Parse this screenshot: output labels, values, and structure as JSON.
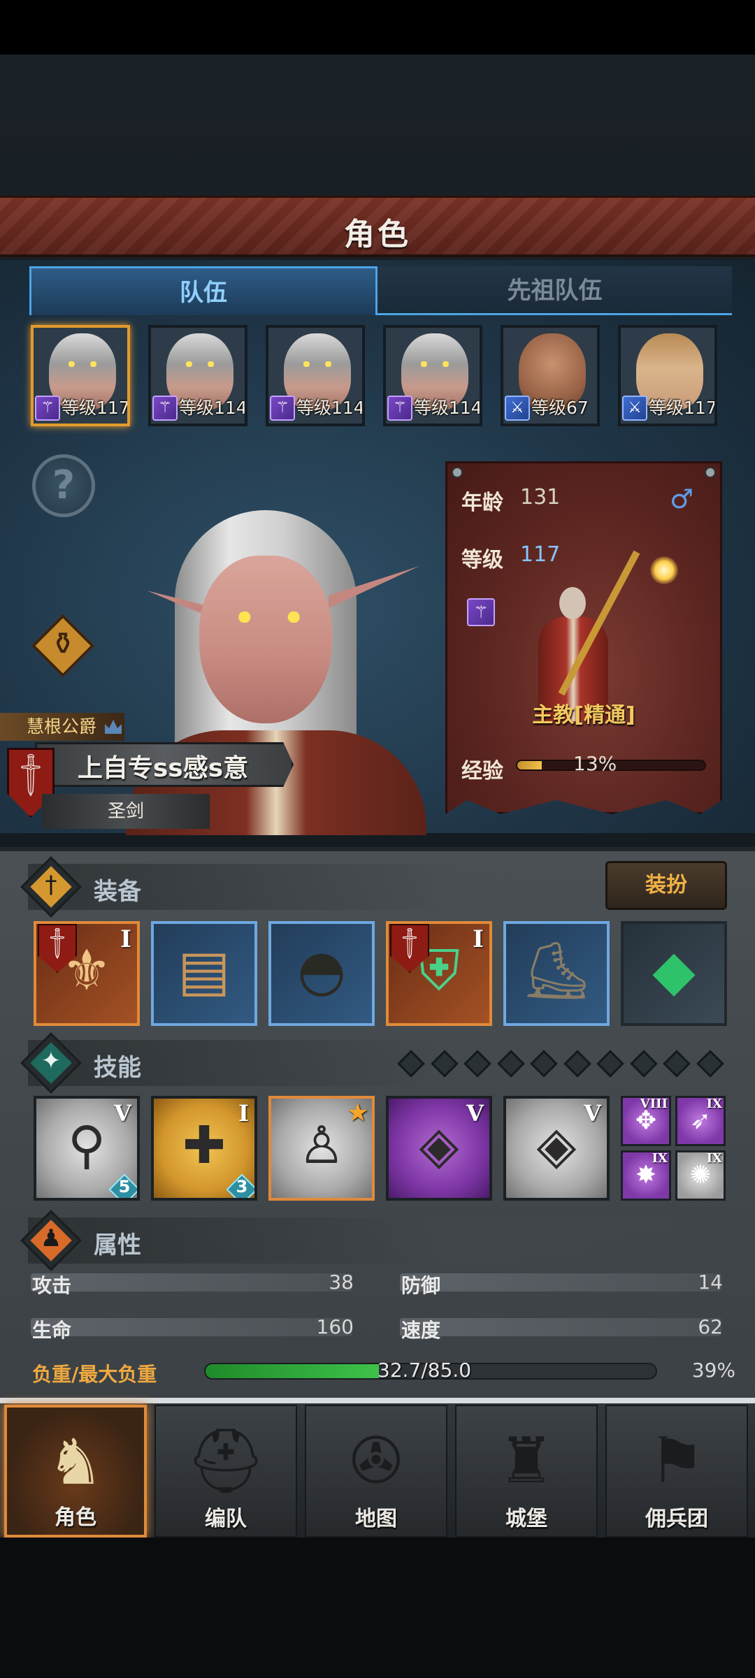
{
  "header": {
    "title": "角色"
  },
  "tabs": [
    {
      "label": "队伍",
      "active": true
    },
    {
      "label": "先祖队伍",
      "active": false
    }
  ],
  "party": [
    {
      "level_text": "等级117",
      "class_icon": "staff-icon",
      "selected": true,
      "portrait": "elf"
    },
    {
      "level_text": "等级114",
      "class_icon": "staff-icon",
      "selected": false,
      "portrait": "elf"
    },
    {
      "level_text": "等级114",
      "class_icon": "staff-icon",
      "selected": false,
      "portrait": "elf"
    },
    {
      "level_text": "等级114",
      "class_icon": "staff-icon",
      "selected": false,
      "portrait": "elf"
    },
    {
      "level_text": "等级67",
      "class_icon": "sword-icon",
      "selected": false,
      "portrait": "bald"
    },
    {
      "level_text": "等级117",
      "class_icon": "sword-icon",
      "selected": false,
      "portrait": "woman"
    }
  ],
  "hero": {
    "noble_title": "慧根公爵",
    "name": "上自专ss感s意",
    "subtitle": "圣剑"
  },
  "info": {
    "age_label": "年龄",
    "age_value": "131",
    "level_label": "等级",
    "level_value": "117",
    "gender_symbol": "♂",
    "class_name": "主教[精通]",
    "exp_label": "经验",
    "exp_percent_text": "13%",
    "exp_fraction": 0.13
  },
  "equipment": {
    "title": "装备",
    "dress_button": "装扮",
    "slots": [
      {
        "name": "weapon",
        "rarity": "orange",
        "tier": "I",
        "icon": "scepter-icon"
      },
      {
        "name": "offhand",
        "rarity": "blue",
        "tier": "",
        "icon": "book-icon"
      },
      {
        "name": "head",
        "rarity": "blue",
        "tier": "",
        "icon": "hood-icon"
      },
      {
        "name": "armor",
        "rarity": "orange",
        "tier": "I",
        "icon": "armor-icon"
      },
      {
        "name": "boots",
        "rarity": "blue",
        "tier": "",
        "icon": "boots-icon"
      },
      {
        "name": "accessory",
        "rarity": "dark",
        "tier": "",
        "icon": "gem-icon"
      }
    ]
  },
  "skills": {
    "title": "技能",
    "pip_count": 10,
    "main": [
      {
        "color": "gray",
        "tier": "V",
        "badge": "5",
        "icon": "holy-spear-icon"
      },
      {
        "color": "gold",
        "tier": "I",
        "badge": "3",
        "icon": "holy-shield-icon"
      },
      {
        "color": "gray",
        "tier": "",
        "badge": "",
        "icon": "prayer-icon",
        "selected": true,
        "starred": true
      },
      {
        "color": "purple",
        "tier": "V",
        "badge": "",
        "icon": "crystal-hand-icon"
      },
      {
        "color": "gray",
        "tier": "V",
        "badge": "",
        "icon": "crystal-hand-icon"
      }
    ],
    "mini": [
      {
        "color": "purple",
        "tier": "VIII",
        "icon": "sun-cross-icon"
      },
      {
        "color": "purple",
        "tier": "IX",
        "icon": "spear-icon"
      },
      {
        "color": "purple",
        "tier": "IX",
        "icon": "burst-icon"
      },
      {
        "color": "gray",
        "tier": "IX",
        "icon": "radiance-icon"
      }
    ]
  },
  "attributes": {
    "title": "属性",
    "attack_label": "攻击",
    "attack_value": "38",
    "defense_label": "防御",
    "defense_value": "14",
    "hp_label": "生命",
    "hp_value": "160",
    "speed_label": "速度",
    "speed_value": "62",
    "load_label": "负重/最大负重",
    "load_text": "32.7/85.0",
    "load_percent_text": "39%",
    "load_fraction": 0.385
  },
  "nav": [
    {
      "label": "角色",
      "icon": "knight-icon",
      "active": true
    },
    {
      "label": "编队",
      "icon": "helmet-icon",
      "active": false
    },
    {
      "label": "地图",
      "icon": "compass-icon",
      "active": false
    },
    {
      "label": "城堡",
      "icon": "castle-icon",
      "active": false
    },
    {
      "label": "佣兵团",
      "icon": "banner-hand-icon",
      "active": false
    }
  ]
}
